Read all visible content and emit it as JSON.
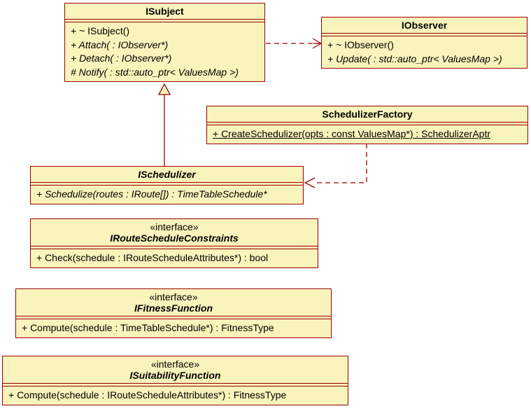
{
  "classes": {
    "isubject": {
      "name": "ISubject",
      "ops": {
        "dtor": "+ ~ ISubject()",
        "attach": "+ Attach( : IObserver*)",
        "detach": "+ Detach( : IObserver*)",
        "notify": "# Notify( : std::auto_ptr< ValuesMap >)"
      }
    },
    "iobserver": {
      "name": "IObserver",
      "ops": {
        "dtor": "+ ~ IObserver()",
        "update": "+ Update( : std::auto_ptr< ValuesMap >)"
      }
    },
    "schedulizerfactory": {
      "name": "SchedulizerFactory",
      "ops": {
        "create": "+ CreateSchedulizer(opts : const ValuesMap*) : SchedulizerAptr"
      }
    },
    "ischedulizer": {
      "name": "ISchedulizer",
      "ops": {
        "schedulize": "+ Schedulize(routes : IRoute[]) : TimeTableSchedule*"
      }
    },
    "irouteconstraints": {
      "stereo": "«interface»",
      "name": "IRouteScheduleConstraints",
      "ops": {
        "check": "+ Check(schedule : IRouteScheduleAttributes*) : bool"
      }
    },
    "ifitness": {
      "stereo": "«interface»",
      "name": "IFitnessFunction",
      "ops": {
        "compute": "+ Compute(schedule : TimeTableSchedule*) : FitnessType"
      }
    },
    "isuitability": {
      "stereo": "«interface»",
      "name": "ISuitabilityFunction",
      "ops": {
        "compute": "+ Compute(schedule : IRouteScheduleAttributes*) : FitnessType"
      }
    }
  },
  "styles": {
    "box_fill": "#f9f3bc",
    "box_border": "#9b0000",
    "rel_color": "#9b0000"
  }
}
